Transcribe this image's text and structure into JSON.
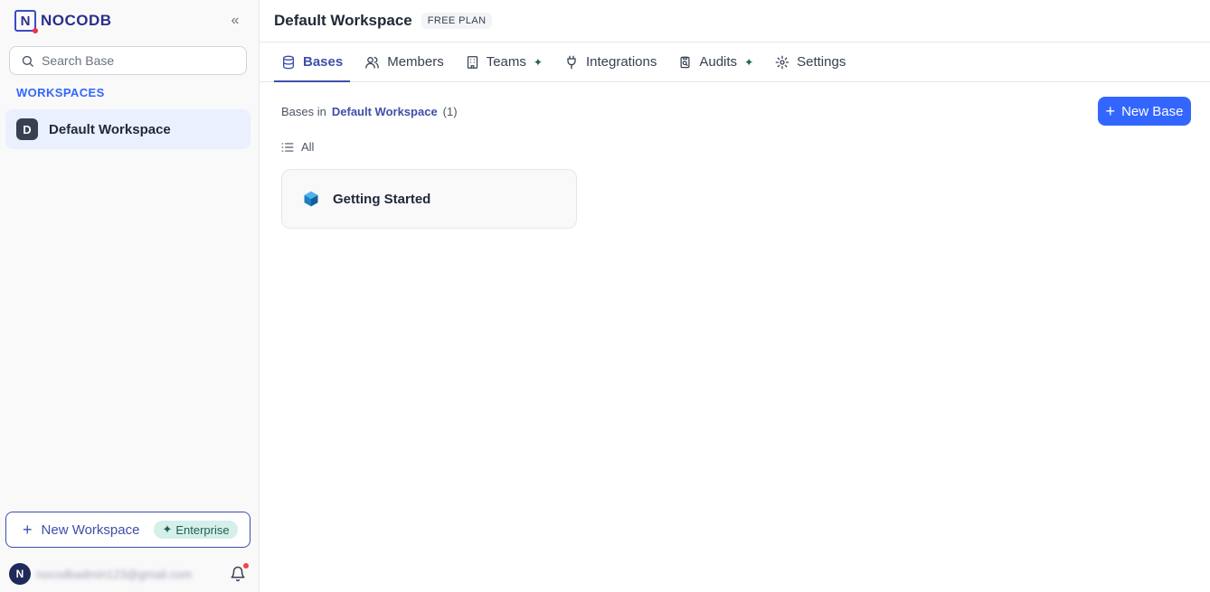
{
  "brand": {
    "logo_letter": "N",
    "name": "NOCODB"
  },
  "sidebar": {
    "search_placeholder": "Search Base",
    "workspaces_heading": "WORKSPACES",
    "workspaces": [
      {
        "initial": "D",
        "name": "Default Workspace"
      }
    ],
    "new_workspace_label": "New Workspace",
    "enterprise_label": "Enterprise",
    "user": {
      "initial": "N",
      "email": "nocodbadmin123@gmail.com"
    }
  },
  "header": {
    "title": "Default Workspace",
    "plan_badge": "FREE PLAN"
  },
  "tabs": [
    {
      "label": "Bases",
      "active": true,
      "icon": "database-icon"
    },
    {
      "label": "Members",
      "active": false,
      "icon": "users-icon"
    },
    {
      "label": "Teams",
      "active": false,
      "icon": "building-icon",
      "spark": true
    },
    {
      "label": "Integrations",
      "active": false,
      "icon": "plug-icon"
    },
    {
      "label": "Audits",
      "active": false,
      "icon": "audit-icon",
      "spark": true
    },
    {
      "label": "Settings",
      "active": false,
      "icon": "gear-icon"
    }
  ],
  "content": {
    "bases_in_label": "Bases in",
    "workspace_link": "Default Workspace",
    "count": "(1)",
    "new_base_label": "New Base",
    "filter_label": "All",
    "bases": [
      {
        "name": "Getting Started"
      }
    ]
  },
  "colors": {
    "accent": "#3366ff",
    "brand": "#3e4fa8",
    "active_workspace_bg": "#ebf0ff",
    "enterprise_bg": "#d5efe9"
  }
}
